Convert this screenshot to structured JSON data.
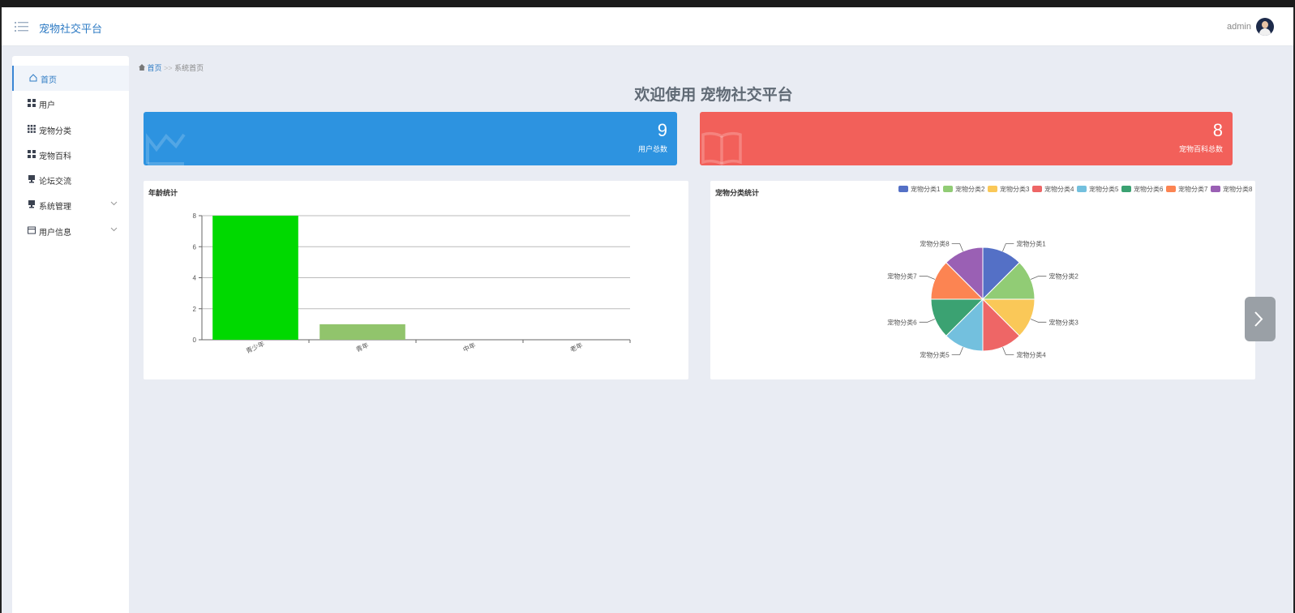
{
  "header": {
    "app_title": "宠物社交平台",
    "user_name": "admin"
  },
  "sidebar": {
    "items": [
      {
        "label": "首页",
        "icon": "home-icon",
        "active": true
      },
      {
        "label": "用户",
        "icon": "grid-icon"
      },
      {
        "label": "宠物分类",
        "icon": "apps-icon"
      },
      {
        "label": "宠物百科",
        "icon": "grid-icon"
      },
      {
        "label": "论坛交流",
        "icon": "monitor-icon"
      },
      {
        "label": "系统管理",
        "icon": "monitor-icon",
        "expandable": true
      },
      {
        "label": "用户信息",
        "icon": "card-icon",
        "expandable": true
      }
    ]
  },
  "breadcrumb": {
    "home": "首页",
    "separator": ">>",
    "current": "系统首页"
  },
  "page_title": "欢迎使用 宠物社交平台",
  "stats": [
    {
      "value": "9",
      "label": "用户总数",
      "color": "#2d93e0"
    },
    {
      "value": "8",
      "label": "宠物百科总数",
      "color": "#f2605a"
    }
  ],
  "age_chart_title": "年龄统计",
  "pet_chart_title": "宠物分类统计",
  "chart_data": [
    {
      "type": "bar",
      "title": "年龄统计",
      "categories": [
        "青少年",
        "青年",
        "中年",
        "老年"
      ],
      "values": [
        8,
        1,
        0,
        0
      ],
      "colors": [
        "#00d900",
        "#91c46c",
        "#91c46c",
        "#91c46c"
      ],
      "ylim": [
        0,
        8
      ],
      "yticks": [
        0,
        2,
        4,
        6,
        8
      ],
      "grid": true
    },
    {
      "type": "pie",
      "title": "宠物分类统计",
      "legend_placement": "top-right",
      "slices": [
        {
          "label": "宠物分类1",
          "value": 1,
          "color": "#5470c6"
        },
        {
          "label": "宠物分类2",
          "value": 1,
          "color": "#91cc75"
        },
        {
          "label": "宠物分类3",
          "value": 1,
          "color": "#fac858"
        },
        {
          "label": "宠物分类4",
          "value": 1,
          "color": "#ee6666"
        },
        {
          "label": "宠物分类5",
          "value": 1,
          "color": "#73c0de"
        },
        {
          "label": "宠物分类6",
          "value": 1,
          "color": "#3ba272"
        },
        {
          "label": "宠物分类7",
          "value": 1,
          "color": "#fc8452"
        },
        {
          "label": "宠物分类8",
          "value": 1,
          "color": "#9a60b4"
        }
      ]
    }
  ]
}
